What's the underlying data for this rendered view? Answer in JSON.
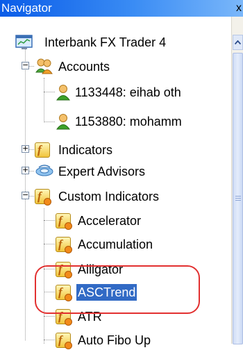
{
  "window": {
    "title": "Navigator"
  },
  "tree": {
    "root": "Interbank FX Trader 4",
    "accounts": "Accounts",
    "account_items": [
      "1133448: eihab oth",
      "1153880: mohamm"
    ],
    "indicators": "Indicators",
    "experts": "Expert Advisors",
    "custom": "Custom Indicators",
    "custom_items": [
      "Accelerator",
      "Accumulation",
      "Alligator",
      "ASCTrend",
      "ATR",
      "Auto Fibo Up"
    ],
    "selected": "ASCTrend"
  },
  "colors": {
    "selection": "#316ac5",
    "annotation_ring": "#e23030",
    "title_bar": "#0a5ce8"
  },
  "icons": {
    "root": "terminal-icon",
    "accounts": "accounts-folder-icon",
    "account_item": "user-account-icon",
    "indicators": "indicator-icon",
    "experts": "expert-advisor-icon",
    "custom": "custom-indicator-icon",
    "expand": "plus-box-icon",
    "collapse": "minus-box-icon"
  }
}
